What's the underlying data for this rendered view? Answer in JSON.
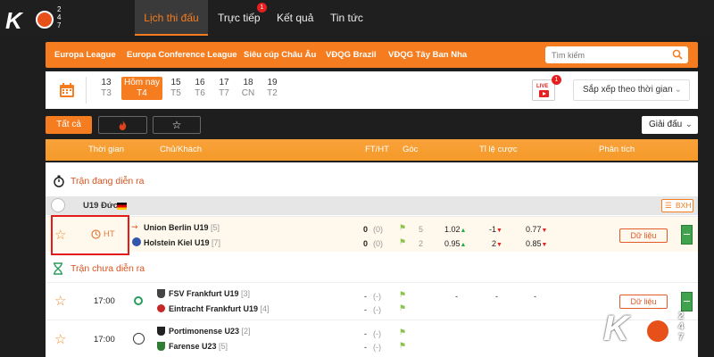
{
  "logo": {
    "letters": "K",
    "nums": "2\n4\n7"
  },
  "nav": [
    {
      "label": "Lịch thi đấu",
      "active": true
    },
    {
      "label": "Trực tiếp",
      "badge": "1"
    },
    {
      "label": "Kết quả"
    },
    {
      "label": "Tin tức"
    }
  ],
  "leagues": [
    "Europa League",
    "Europa Conference League",
    "Siêu cúp Châu Âu",
    "VĐQG Brazil",
    "VĐQG Tây Ban Nha"
  ],
  "search": {
    "placeholder": "Tìm kiếm"
  },
  "days": [
    {
      "num": "13",
      "dow": "T3"
    },
    {
      "num": "Hôm nay",
      "dow": "T4"
    },
    {
      "num": "15",
      "dow": "T5"
    },
    {
      "num": "16",
      "dow": "T6"
    },
    {
      "num": "17",
      "dow": "T7"
    },
    {
      "num": "18",
      "dow": "CN"
    },
    {
      "num": "19",
      "dow": "T2"
    }
  ],
  "live": {
    "label": "LIVE",
    "badge": "1"
  },
  "sort": {
    "label": "Sắp xếp theo thời gian"
  },
  "filters": {
    "all": "Tất cả"
  },
  "giaidau": "Giải đấu",
  "headers": [
    "Thời gian",
    "Chủ/Khách",
    "FT/HT",
    "Góc",
    "Tỉ lệ cược",
    "Phân tích"
  ],
  "sections": {
    "live": "Trận đang diễn ra",
    "upcoming": "Trận chưa diễn ra"
  },
  "liveLeague": {
    "name": "U19 Đức",
    "bxh": "BXH"
  },
  "liveMatch": {
    "status": "HT",
    "home": {
      "name": "Union Berlin U19",
      "rank": "[5]",
      "ft": "0",
      "ht": "(0)",
      "corner": "5",
      "o1": "1.02",
      "o2": "-1",
      "o3": "0.77"
    },
    "away": {
      "name": "Holstein Kiel U19",
      "rank": "[7]",
      "ft": "0",
      "ht": "(0)",
      "corner": "2",
      "o1": "0.95",
      "o2": "2",
      "o3": "0.85"
    },
    "data": "Dữ liệu"
  },
  "upcoming": [
    {
      "time": "17:00",
      "home": {
        "name": "FSV Frankfurt U19",
        "rank": "[3]"
      },
      "away": {
        "name": "Eintracht Frankfurt U19",
        "rank": "[4]"
      },
      "dash": "-",
      "par": "(-)",
      "data": "Dữ liệu"
    },
    {
      "time": "17:00",
      "home": {
        "name": "Portimonense U23",
        "rank": "[2]"
      },
      "away": {
        "name": "Farense U23",
        "rank": "[5]"
      },
      "dash": "-",
      "par": "(-)"
    }
  ]
}
